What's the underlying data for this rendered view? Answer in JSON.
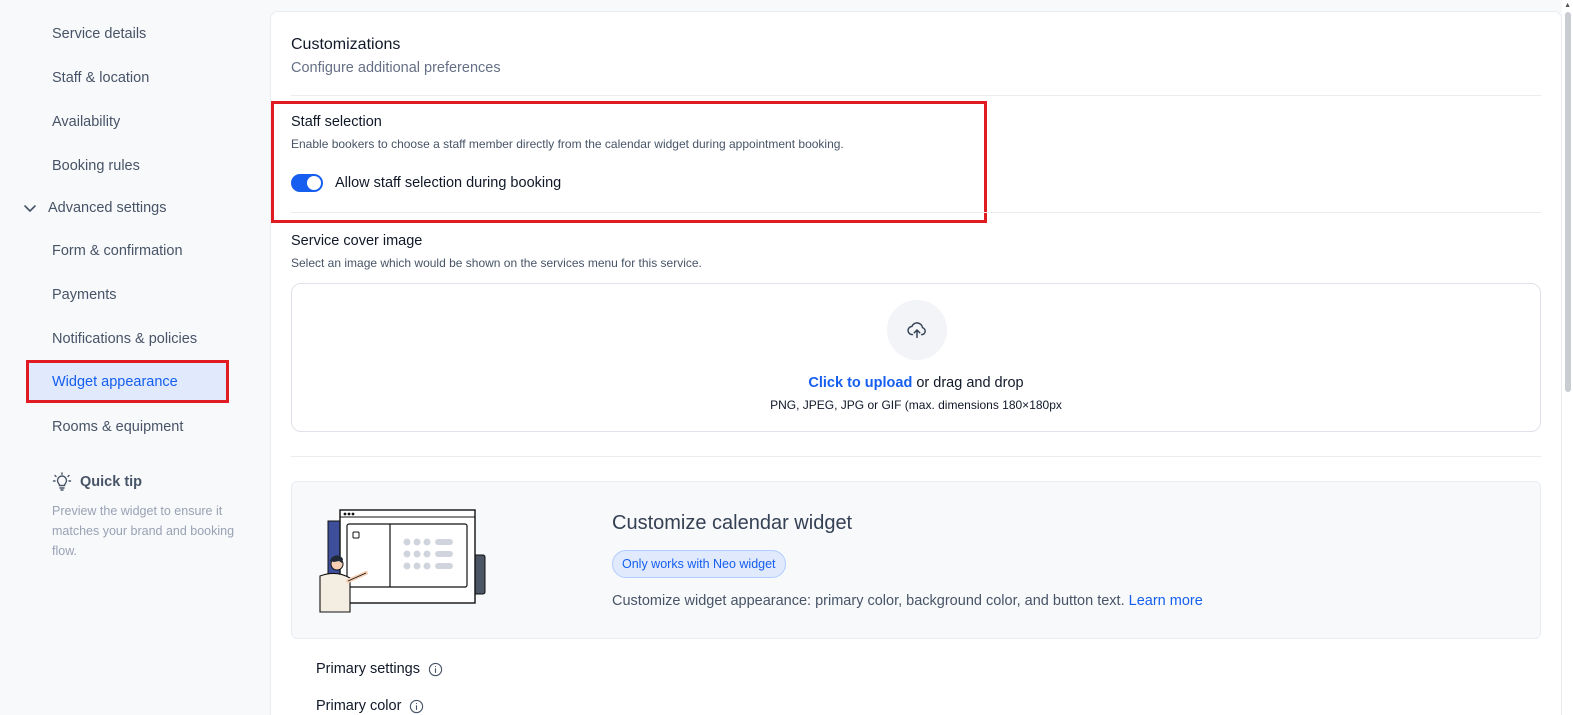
{
  "sidebar": {
    "items": [
      {
        "label": "Service details"
      },
      {
        "label": "Staff & location"
      },
      {
        "label": "Availability"
      },
      {
        "label": "Booking rules"
      }
    ],
    "group_label": "Advanced settings",
    "sub_items": [
      {
        "label": "Form & confirmation"
      },
      {
        "label": "Payments"
      },
      {
        "label": "Notifications & policies"
      },
      {
        "label": "Widget appearance",
        "active": true
      },
      {
        "label": "Rooms & equipment"
      }
    ],
    "quick_tip": {
      "title": "Quick tip",
      "text": "Preview the widget to ensure it matches your brand and booking flow."
    }
  },
  "main": {
    "title": "Customizations",
    "subtitle": "Configure additional preferences",
    "staff_selection": {
      "title": "Staff selection",
      "description": "Enable bookers to choose a staff member directly from the calendar widget during appointment booking.",
      "toggle_label": "Allow staff selection during booking",
      "toggle_on": true
    },
    "cover_image": {
      "title": "Service cover image",
      "description": "Select an image which would be shown on the services menu for this service.",
      "upload_link": "Click to upload",
      "upload_rest": " or drag and drop",
      "upload_hint": "PNG, JPEG, JPG or GIF (max. dimensions 180×180px"
    },
    "calendar_widget": {
      "title": "Customize calendar widget",
      "badge": "Only works with Neo widget",
      "description": "Customize widget appearance: primary color, background color, and button text. ",
      "learn_more": "Learn more"
    },
    "primary_settings_label": "Primary settings",
    "primary_color_label": "Primary color"
  },
  "colors": {
    "accent": "#155eef",
    "highlight_border": "#e01b22",
    "active_bg": "#e0eafc"
  }
}
